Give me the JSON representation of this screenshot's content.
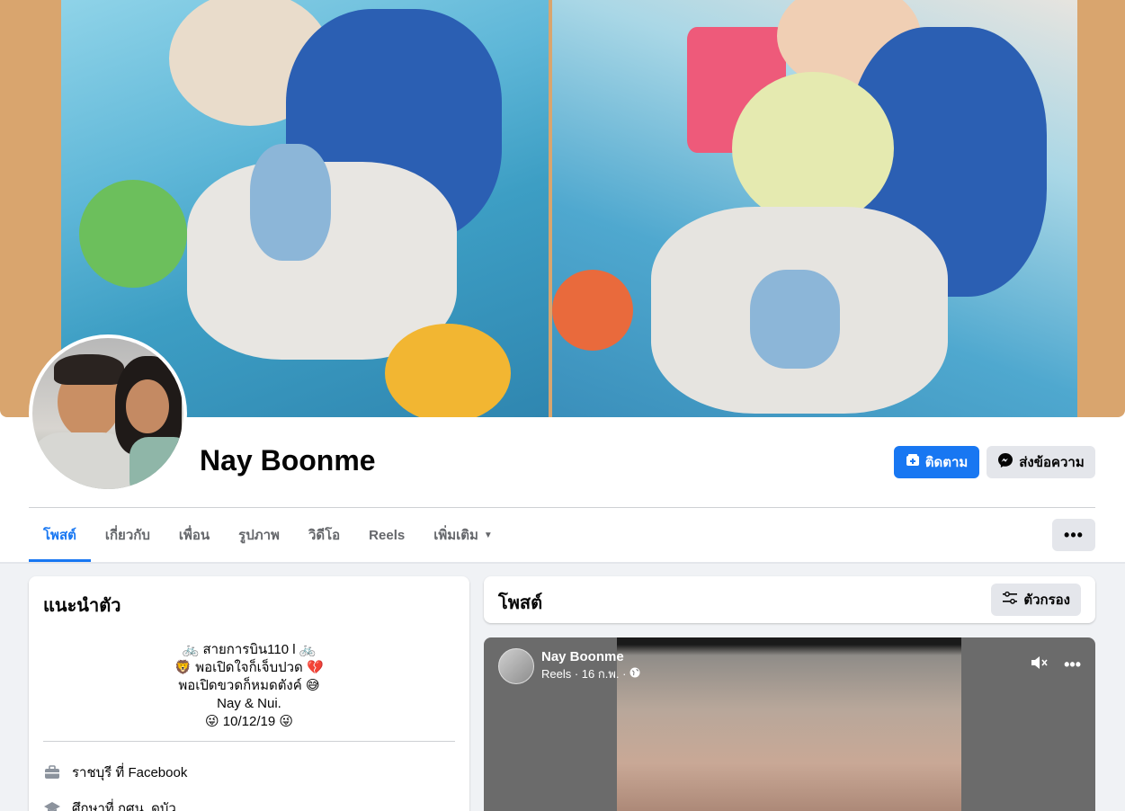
{
  "profile": {
    "name": "Nay Boonme"
  },
  "actions": {
    "follow_label": "ติดตาม",
    "message_label": "ส่งข้อความ",
    "more_label": "•••"
  },
  "tabs": [
    {
      "label": "โพสต์",
      "active": true
    },
    {
      "label": "เกี่ยวกับ",
      "active": false
    },
    {
      "label": "เพื่อน",
      "active": false
    },
    {
      "label": "รูปภาพ",
      "active": false
    },
    {
      "label": "วิดีโอ",
      "active": false
    },
    {
      "label": "Reels",
      "active": false
    },
    {
      "label": "เพิ่มเติม",
      "active": false
    }
  ],
  "intro": {
    "title": "แนะนำตัว",
    "bio_lines": [
      "🚲 สายการบิน110 l 🚲",
      "🦁 พอเปิดใจก็เจ็บปวด 💔",
      "พอเปิดขวดก็หมดตังค์ 😅",
      "Nay & Nui.",
      "😜 10/12/19 😜"
    ],
    "work": "ราชบุรี ที่ Facebook",
    "education": "ศึกษาที่ กศน. ดบัว"
  },
  "posts": {
    "title": "โพสต์",
    "filter_label": "ตัวกรอง"
  },
  "reel": {
    "author": "Nay Boonme",
    "meta": "Reels · 16 ก.พ. ·"
  },
  "colors": {
    "accent": "#1877f2",
    "background": "#f0f2f5",
    "secondary_button": "#e4e6eb"
  }
}
